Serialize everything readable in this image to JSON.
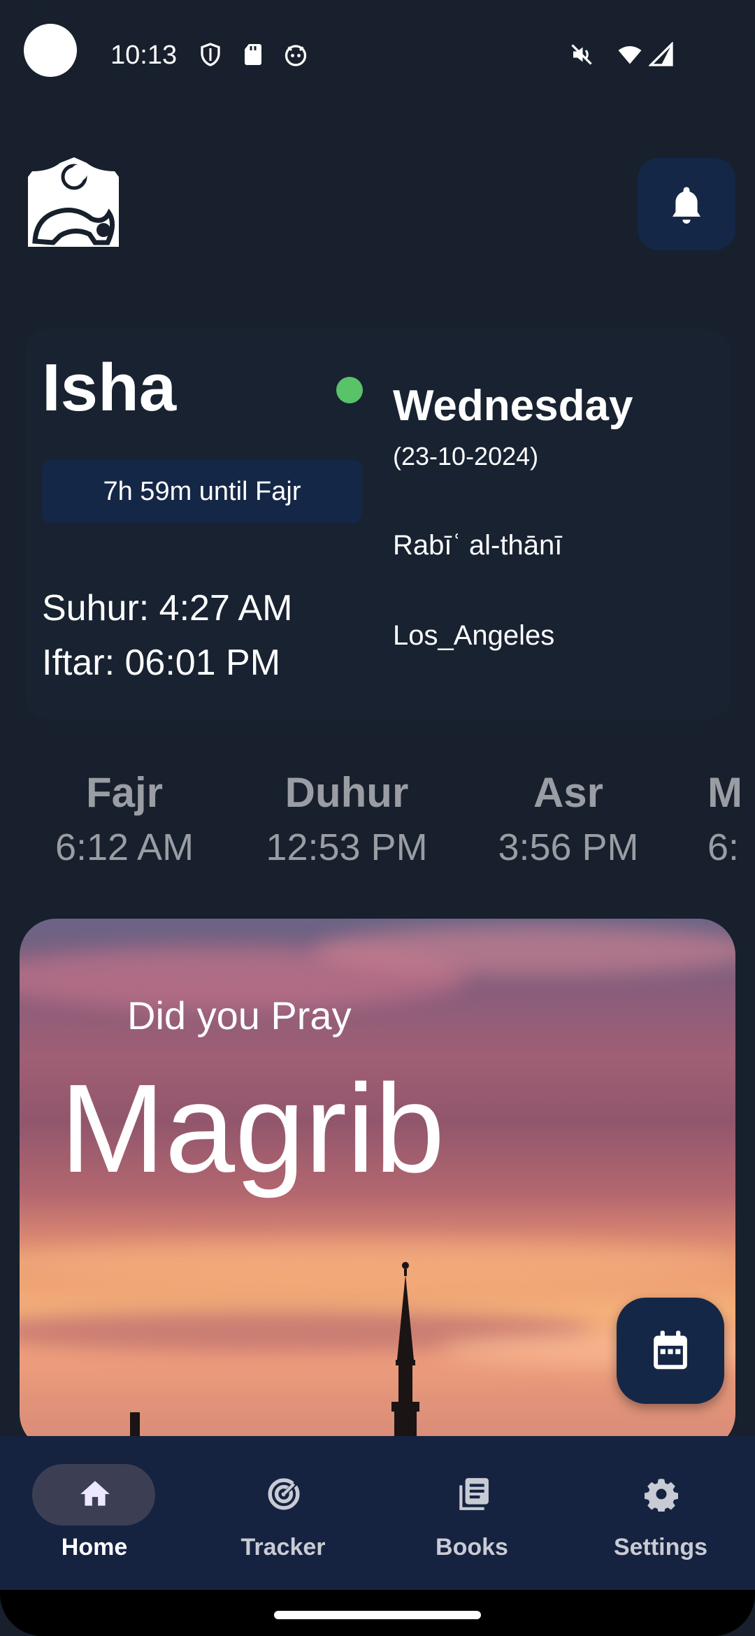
{
  "status_bar": {
    "time": "10:13"
  },
  "header": {
    "logo_icon": "prayer-mat-logo-icon",
    "bell_icon": "bell-icon"
  },
  "info": {
    "current_prayer": "Isha",
    "countdown": "7h 59m until Fajr",
    "suhur": "Suhur: 4:27 AM",
    "iftar": "Iftar: 06:01 PM",
    "weekday": "Wednesday",
    "date": "(23-10-2024)",
    "hijri_month": "Rabīʿ al-thānī",
    "location": "Los_Angeles",
    "status_color": "#59c36a"
  },
  "prayer_times": [
    {
      "name": "Fajr",
      "time": "6:12 AM"
    },
    {
      "name": "Duhur",
      "time": "12:53 PM"
    },
    {
      "name": "Asr",
      "time": "3:56 PM"
    },
    {
      "name": "M",
      "time": "6:"
    }
  ],
  "prompt_card": {
    "subtitle": "Did you Pray",
    "prayer": "Magrib"
  },
  "nav": [
    {
      "label": "Home",
      "icon": "home-icon",
      "active": true
    },
    {
      "label": "Tracker",
      "icon": "tracker-icon",
      "active": false
    },
    {
      "label": "Books",
      "icon": "books-icon",
      "active": false
    },
    {
      "label": "Settings",
      "icon": "gear-icon",
      "active": false
    }
  ],
  "colors": {
    "background": "#17202c",
    "accent": "#152747",
    "nav_background": "#152340"
  }
}
